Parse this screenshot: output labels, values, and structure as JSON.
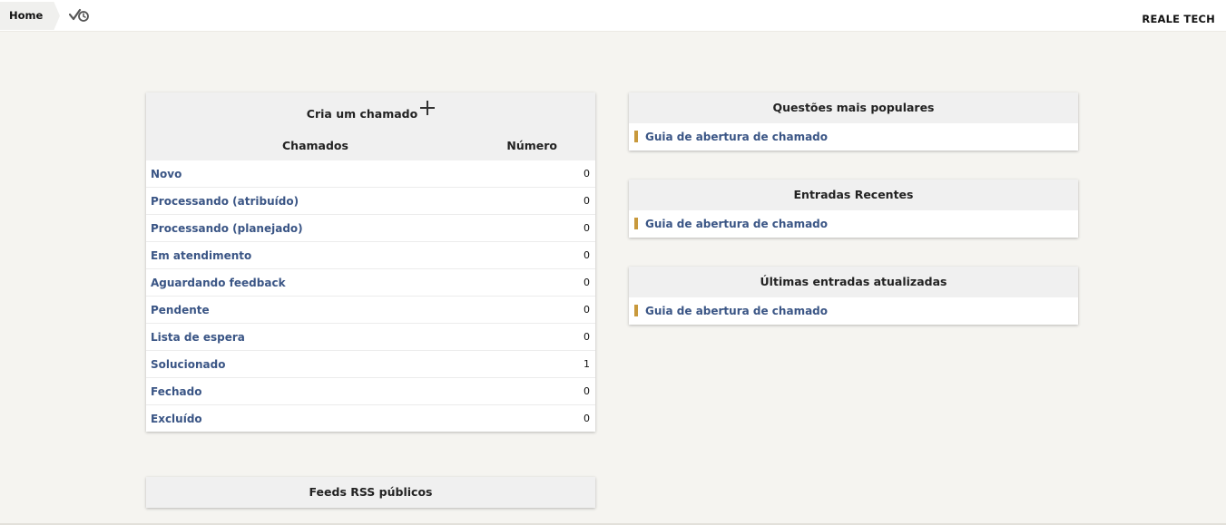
{
  "topbar": {
    "breadcrumb_home": "Home",
    "brand": "REALE TECH"
  },
  "tickets": {
    "create_label": "Cria um chamado",
    "col_name": "Chamados",
    "col_number": "Número",
    "rows": [
      {
        "label": "Novo",
        "count": "0"
      },
      {
        "label": "Processando (atribuído)",
        "count": "0"
      },
      {
        "label": "Processando (planejado)",
        "count": "0"
      },
      {
        "label": "Em atendimento",
        "count": "0"
      },
      {
        "label": "Aguardando feedback",
        "count": "0"
      },
      {
        "label": "Pendente",
        "count": "0"
      },
      {
        "label": "Lista de espera",
        "count": "0"
      },
      {
        "label": "Solucionado",
        "count": "1"
      },
      {
        "label": "Fechado",
        "count": "0"
      },
      {
        "label": "Excluído",
        "count": "0"
      }
    ]
  },
  "rss": {
    "title": "Feeds RSS públicos"
  },
  "faq": {
    "popular": {
      "title": "Questões mais populares",
      "items": [
        "Guia de abertura de chamado"
      ]
    },
    "recent": {
      "title": "Entradas Recentes",
      "items": [
        "Guia de abertura de chamado"
      ]
    },
    "updated": {
      "title": "Últimas entradas atualizadas",
      "items": [
        "Guia de abertura de chamado"
      ]
    }
  },
  "colors": {
    "link": "#3a5585",
    "accent_bar": "#c8993c",
    "panel_header": "#f0f0f0",
    "background": "#f5f4f0"
  },
  "icons": {
    "status_icon": "check-clock-icon",
    "create_icon": "plus-icon"
  }
}
